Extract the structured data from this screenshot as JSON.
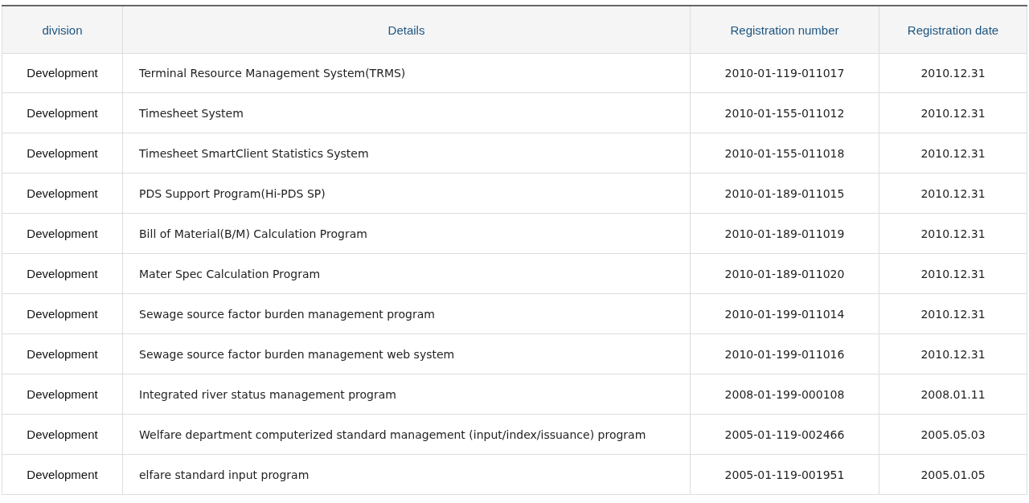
{
  "table": {
    "columns": [
      "division",
      "Details",
      "Registration number",
      "Registration date"
    ],
    "rows": [
      [
        "Development",
        "Terminal Resource Management System(TRMS)",
        "2010-01-119-011017",
        "2010.12.31"
      ],
      [
        "Development",
        "Timesheet System",
        "2010-01-155-011012",
        "2010.12.31"
      ],
      [
        "Development",
        "Timesheet SmartClient Statistics System",
        "2010-01-155-011018",
        "2010.12.31"
      ],
      [
        "Development",
        "PDS Support Program(Hi-PDS SP)",
        "2010-01-189-011015",
        "2010.12.31"
      ],
      [
        "Development",
        "Bill of Material(B/M)  Calculation Program",
        "2010-01-189-011019",
        "2010.12.31"
      ],
      [
        "Development",
        "Mater Spec Calculation Program",
        "2010-01-189-011020",
        "2010.12.31"
      ],
      [
        "Development",
        "Sewage source factor burden management program",
        "2010-01-199-011014",
        "2010.12.31"
      ],
      [
        "Development",
        "Sewage source factor burden management web system",
        "2010-01-199-011016",
        "2010.12.31"
      ],
      [
        "Development",
        "Integrated river status management program",
        "2008-01-199-000108",
        "2008.01.11"
      ],
      [
        "Development",
        "Welfare department computerized standard management (input/index/issuance) program",
        "2005-01-119-002466",
        "2005.05.03"
      ],
      [
        "Development",
        "elfare standard input program",
        "2005-01-119-001951",
        "2005.01.05"
      ]
    ]
  }
}
